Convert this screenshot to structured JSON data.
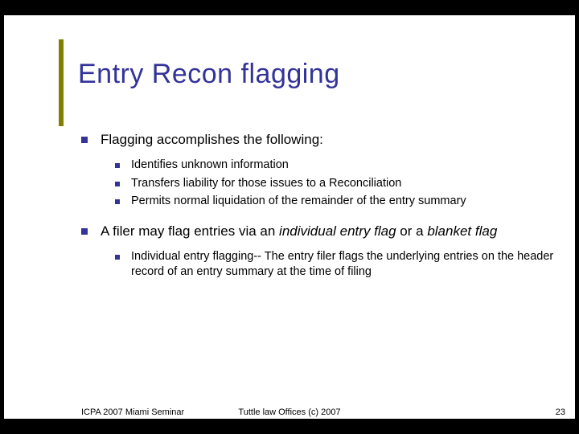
{
  "title": "Entry Recon flagging",
  "bullet1": {
    "text": "Flagging accomplishes the following:",
    "sub": [
      "Identifies unknown information",
      "Transfers liability for those issues to a Reconciliation",
      "Permits normal liquidation of the remainder of the entry summary"
    ]
  },
  "bullet2": {
    "pre": "A filer may flag entries via an ",
    "em1": "individual entry flag",
    "mid": " or a ",
    "em2": "blanket flag",
    "sub": [
      "Individual entry flagging-- The entry filer flags the underlying entries on the header record of an entry summary at the time of filing"
    ]
  },
  "footer": {
    "left": "ICPA 2007 Miami Seminar",
    "center": "Tuttle law Offices (c) 2007",
    "right": "23"
  }
}
